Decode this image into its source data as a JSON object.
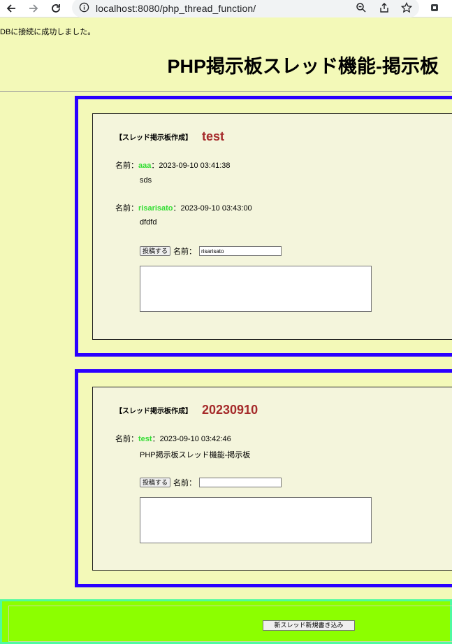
{
  "browser": {
    "url": "localhost:8080/php_thread_function/"
  },
  "page": {
    "status": "DBに接続に成功しました。",
    "title": "PHP掲示板スレッド機能-掲示板"
  },
  "threads": [
    {
      "tag": "【スレッド掲示板作成】",
      "title": "test",
      "posts": [
        {
          "label": "名前：",
          "name": "aaa",
          "sep": "：",
          "time": "2023-09-10 03:41:38",
          "body": "sds"
        },
        {
          "label": "名前：",
          "name": "risarisato",
          "sep": "：",
          "time": "2023-09-10 03:43:00",
          "body": "dfdfd"
        }
      ],
      "reply": {
        "button": "投稿する",
        "name_label": "名前：",
        "name_value": "risarisato"
      }
    },
    {
      "tag": "【スレッド掲示板作成】",
      "title": "20230910",
      "posts": [
        {
          "label": "名前：",
          "name": "test",
          "sep": "：",
          "time": "2023-09-10 03:42:46",
          "body": "PHP掲示板スレッド機能-掲示板"
        }
      ],
      "reply": {
        "button": "投稿する",
        "name_label": "名前：",
        "name_value": ""
      }
    }
  ],
  "footer": {
    "new_thread_button": "新スレッド新規書き込み"
  },
  "colors": {
    "page_bg": "#f3f9b8",
    "thread_border": "#2a00ff",
    "thread_title": "#a52a2a",
    "post_name": "#33dd33",
    "footer_bg": "#8cff00"
  }
}
